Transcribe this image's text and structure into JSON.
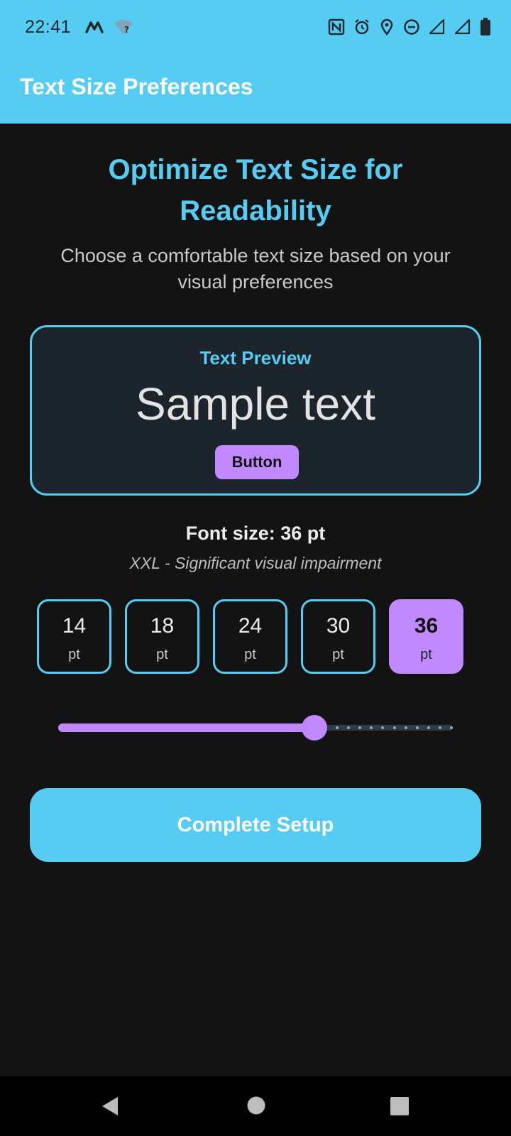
{
  "status_bar": {
    "time": "22:41",
    "left_icons": [
      "m-logo-icon",
      "wifi-question-icon"
    ],
    "right_icons": [
      "nfc-icon",
      "alarm-icon",
      "location-icon",
      "dnd-icon",
      "signal-icon",
      "signal-icon-2",
      "battery-icon"
    ]
  },
  "app_bar": {
    "title": "Text Size Preferences"
  },
  "main": {
    "headline": "Optimize Text Size for Readability",
    "subtext": "Choose a comfortable text size based on your visual preferences"
  },
  "preview": {
    "label": "Text Preview",
    "sample_text": "Sample text",
    "button_label": "Button"
  },
  "current": {
    "font_size_label": "Font size: 36 pt",
    "description": "XXL - Significant visual impairment"
  },
  "size_options": [
    {
      "value": "14",
      "unit": "pt",
      "selected": false
    },
    {
      "value": "18",
      "unit": "pt",
      "selected": false
    },
    {
      "value": "24",
      "unit": "pt",
      "selected": false
    },
    {
      "value": "30",
      "unit": "pt",
      "selected": false
    },
    {
      "value": "36",
      "unit": "pt",
      "selected": true
    }
  ],
  "slider": {
    "fraction": 0.65,
    "tick_count": 11
  },
  "actions": {
    "complete_label": "Complete Setup"
  },
  "colors": {
    "primary": "#56ccf2",
    "accent": "#c189ff",
    "background": "#131313",
    "card": "#1c252b"
  },
  "nav_icons": [
    "back-icon",
    "home-icon",
    "recents-icon"
  ]
}
